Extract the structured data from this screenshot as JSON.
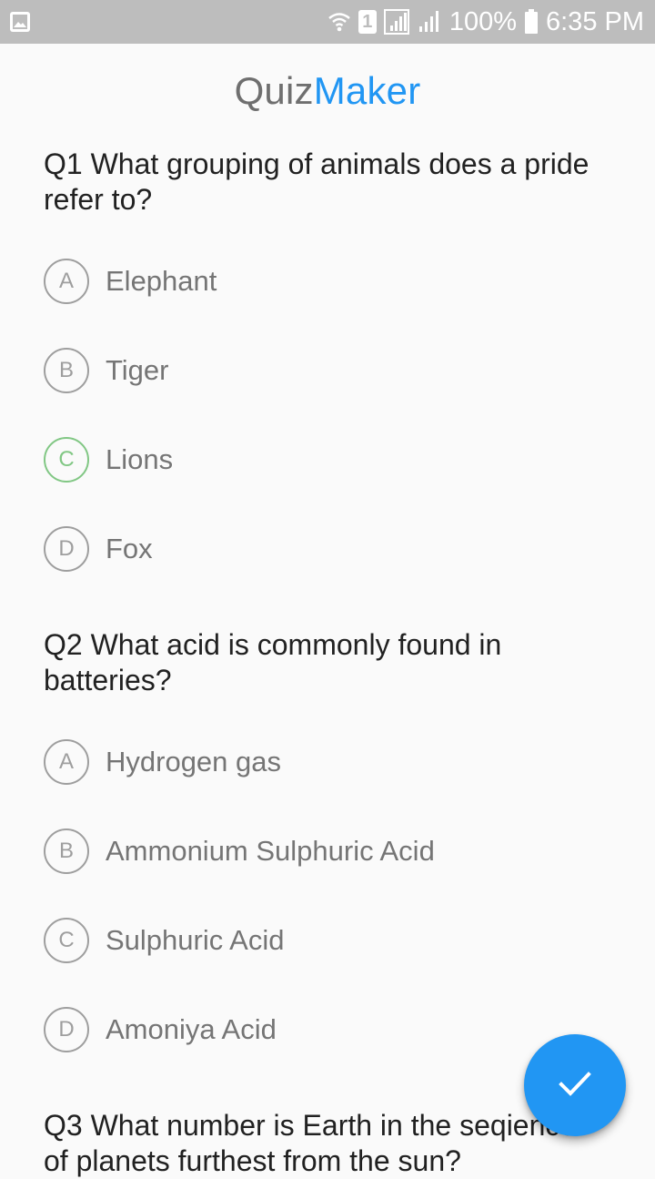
{
  "status_bar": {
    "battery_percent": "100%",
    "time": "6:35 PM",
    "sim_indicator": "1",
    "icons": [
      "gallery-icon",
      "wifi-icon",
      "sim-icon",
      "signal-icon",
      "signal-icon",
      "battery-icon"
    ]
  },
  "app": {
    "title_part1": "Quiz",
    "title_part2": "Maker",
    "colors": {
      "title_gray": "#6f6f6f",
      "title_blue": "#2196f3",
      "accent": "#2196f3",
      "selected": "#81c784"
    }
  },
  "questions": [
    {
      "text": "Q1 What grouping of animals does a pride refer to?",
      "options": [
        {
          "letter": "A",
          "label": "Elephant",
          "selected": false
        },
        {
          "letter": "B",
          "label": "Tiger",
          "selected": false
        },
        {
          "letter": "C",
          "label": "Lions",
          "selected": true
        },
        {
          "letter": "D",
          "label": "Fox",
          "selected": false
        }
      ]
    },
    {
      "text": "Q2 What acid is commonly found in batteries?",
      "options": [
        {
          "letter": "A",
          "label": "Hydrogen gas",
          "selected": false
        },
        {
          "letter": "B",
          "label": "Ammonium Sulphuric Acid",
          "selected": false
        },
        {
          "letter": "C",
          "label": "Sulphuric Acid",
          "selected": false
        },
        {
          "letter": "D",
          "label": "Amoniya Acid",
          "selected": false
        }
      ]
    },
    {
      "text": "Q3 What number is Earth in the seqience of planets furthest from the sun?"
    }
  ],
  "fab": {
    "icon": "check-icon"
  }
}
